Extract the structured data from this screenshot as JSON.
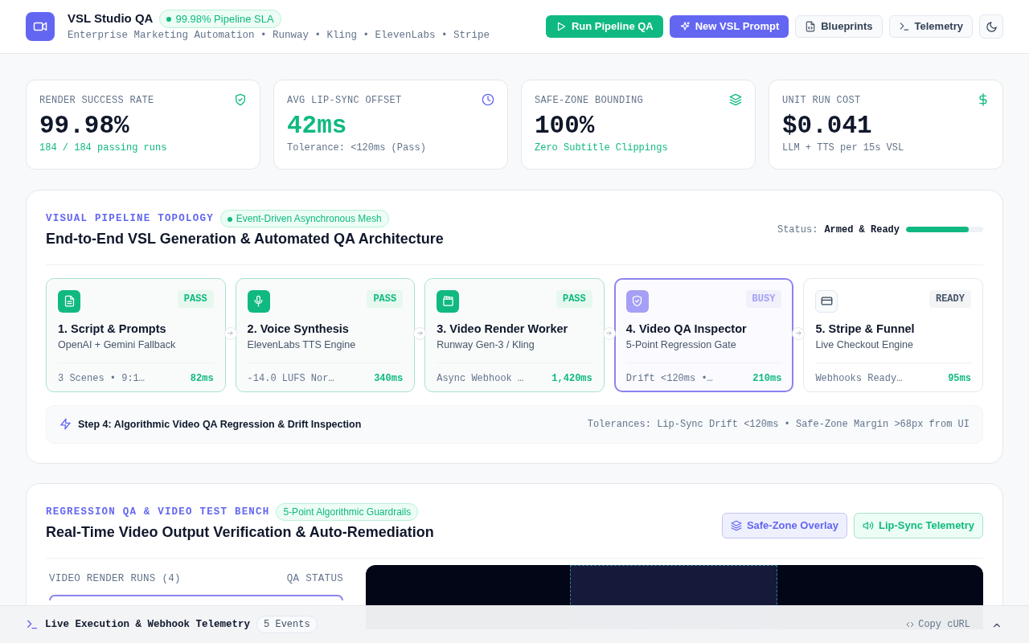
{
  "header": {
    "title": "VSL Studio QA",
    "sla_badge": "99.98% Pipeline SLA",
    "subtitle": "Enterprise Marketing Automation • Runway • Kling • ElevenLabs • Stripe",
    "actions": [
      {
        "label": "Run Pipeline QA",
        "kind": "success"
      },
      {
        "label": "New VSL Prompt",
        "kind": "primary"
      },
      {
        "label": "Blueprints",
        "kind": "outline"
      },
      {
        "label": "Telemetry",
        "kind": "outline"
      }
    ]
  },
  "kpis": [
    {
      "label": "RENDER SUCCESS RATE",
      "value": "99.98%",
      "note": "184 / 184 passing runs",
      "value_highlight": false,
      "note_highlight": true
    },
    {
      "label": "AVG LIP-SYNC OFFSET",
      "value": "42ms",
      "note": "Tolerance: <120ms (Pass)",
      "value_highlight": true,
      "note_highlight": false
    },
    {
      "label": "SAFE-ZONE BOUNDING",
      "value": "100%",
      "note": "Zero Subtitle Clippings",
      "value_highlight": false,
      "note_highlight": true
    },
    {
      "label": "UNIT RUN COST",
      "value": "$0.041",
      "note": "LLM + TTS per 15s VSL",
      "value_highlight": false,
      "note_highlight": false
    }
  ],
  "topology": {
    "eyebrow": "VISUAL PIPELINE TOPOLOGY",
    "badge": "Event-Driven Asynchronous Mesh",
    "title": "End-to-End VSL Generation & Automated QA Architecture",
    "status_label": "Status:",
    "status_value": "Armed & Ready",
    "level": 0.81,
    "stages": [
      {
        "title": "1. Script & Prompts",
        "subtitle": "OpenAI + Gemini Fallback",
        "detail": "3 Scenes • 9:1…",
        "latency": "82ms",
        "kind": "pass",
        "state": "PASS"
      },
      {
        "title": "2. Voice Synthesis",
        "subtitle": "ElevenLabs TTS Engine",
        "detail": "-14.0 LUFS Nor…",
        "latency": "340ms",
        "kind": "pass",
        "state": "PASS"
      },
      {
        "title": "3. Video Render Worker",
        "subtitle": "Runway Gen-3 / Kling",
        "detail": "Async Webhook …",
        "latency": "1,420ms",
        "kind": "pass",
        "state": "PASS"
      },
      {
        "title": "4. Video QA Inspector",
        "subtitle": "5-Point Regression Gate",
        "detail": "Drift <120ms •…",
        "latency": "210ms",
        "kind": "busy",
        "state": "BUSY"
      },
      {
        "title": "5. Stripe & Funnel",
        "subtitle": "Live Checkout Engine",
        "detail": "Webhooks Ready…",
        "latency": "95ms",
        "kind": "ready",
        "state": "READY"
      }
    ],
    "step_note": "Step 4: Algorithmic Video QA Regression & Drift Inspection",
    "tolerances": "Tolerances: Lip-Sync Drift <120ms • Safe-Zone Margin >68px from UI"
  },
  "regression": {
    "eyebrow": "REGRESSION QA & VIDEO TEST BENCH",
    "badge": "5-Point Algorithmic Guardrails",
    "title": "Real-Time Video Output Verification & Auto-Remediation",
    "toggles": [
      {
        "label": "Safe-Zone Overlay",
        "selected": true,
        "kind": "indigo"
      },
      {
        "label": "Lip-Sync Telemetry",
        "selected": true,
        "kind": "green"
      }
    ],
    "runs_header": "VIDEO RENDER RUNS (4)",
    "status_header": "QA STATUS"
  },
  "console": {
    "title": "Live Execution & Webhook Telemetry",
    "count": "5 Events",
    "copy": "Copy cURL",
    "expanded": false
  }
}
